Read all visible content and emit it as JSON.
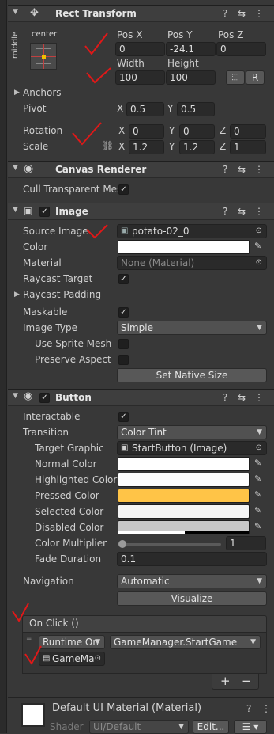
{
  "rect_transform": {
    "title": "Rect Transform",
    "anchor_h": "center",
    "anchor_v": "middle",
    "pos_x_label": "Pos X",
    "pos_y_label": "Pos Y",
    "pos_z_label": "Pos Z",
    "pos_x": "0",
    "pos_y": "-24.1",
    "pos_z": "0",
    "width_label": "Width",
    "height_label": "Height",
    "width": "100",
    "height": "100",
    "r_button": "R",
    "anchors": "Anchors",
    "pivot": "Pivot",
    "pivot_x": "0.5",
    "pivot_y": "0.5",
    "rotation": "Rotation",
    "rot_x": "0",
    "rot_y": "0",
    "rot_z": "0",
    "scale": "Scale",
    "scale_x": "1.2",
    "scale_y": "1.2",
    "scale_z": "1",
    "x": "X",
    "y": "Y",
    "z": "Z"
  },
  "canvas_renderer": {
    "title": "Canvas Renderer",
    "cull": "Cull Transparent Mes"
  },
  "image": {
    "title": "Image",
    "source_image_label": "Source Image",
    "source_image": "potato-02_0",
    "color_label": "Color",
    "material_label": "Material",
    "material": "None (Material)",
    "raycast_target": "Raycast Target",
    "raycast_padding": "Raycast Padding",
    "maskable": "Maskable",
    "image_type_label": "Image Type",
    "image_type": "Simple",
    "use_sprite_mesh": "Use Sprite Mesh",
    "preserve_aspect": "Preserve Aspect",
    "set_native_size": "Set Native Size"
  },
  "button": {
    "title": "Button",
    "interactable": "Interactable",
    "transition_label": "Transition",
    "transition": "Color Tint",
    "target_graphic_label": "Target Graphic",
    "target_graphic": "StartButton (Image)",
    "normal_color": "Normal Color",
    "highlighted_color": "Highlighted Color",
    "pressed_color": "Pressed Color",
    "selected_color": "Selected Color",
    "disabled_color": "Disabled Color",
    "color_multiplier": "Color Multiplier",
    "color_multiplier_value": "1",
    "color_multiplier_fraction": 0.0,
    "fade_duration": "Fade Duration",
    "fade_duration_value": "0.1",
    "navigation_label": "Navigation",
    "navigation": "Automatic",
    "visualize": "Visualize",
    "colors": {
      "normal": "#ffffff",
      "highlighted": "#ffffff",
      "pressed": "#ffc447",
      "selected": "#f5f5f5",
      "disabled": "#c8c8c8"
    }
  },
  "on_click": {
    "title": "On Click ()",
    "runtime": "Runtime On",
    "function": "GameManager.StartGame",
    "object": "GameMa",
    "plus": "+",
    "minus": "−"
  },
  "material": {
    "title": "Default UI Material (Material)",
    "shader_label": "Shader",
    "shader": "UI/Default",
    "edit": "Edit..."
  }
}
